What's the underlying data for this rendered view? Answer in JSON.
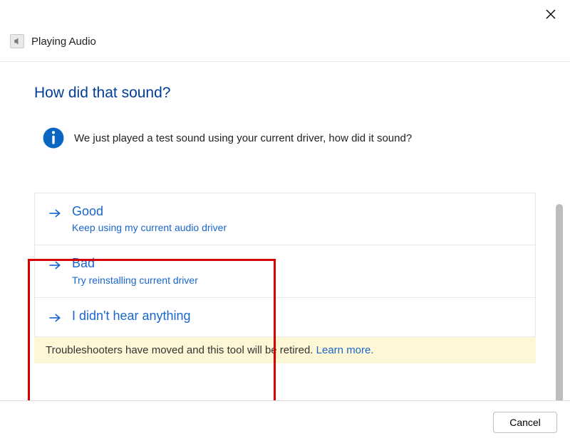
{
  "titlebar": {
    "close_aria": "Close"
  },
  "header": {
    "title": "Playing Audio"
  },
  "page": {
    "heading": "How did that sound?",
    "info_text": "We just played a test sound using your current driver, how did it sound?"
  },
  "options": [
    {
      "title": "Good",
      "subtitle": "Keep using my current audio driver"
    },
    {
      "title": "Bad",
      "subtitle": "Try reinstalling current driver"
    },
    {
      "title": "I didn't hear anything",
      "subtitle": ""
    }
  ],
  "banner": {
    "text": "Troubleshooters have moved and this tool will be retired. ",
    "link_text": "Learn more."
  },
  "footer": {
    "cancel_label": "Cancel"
  }
}
